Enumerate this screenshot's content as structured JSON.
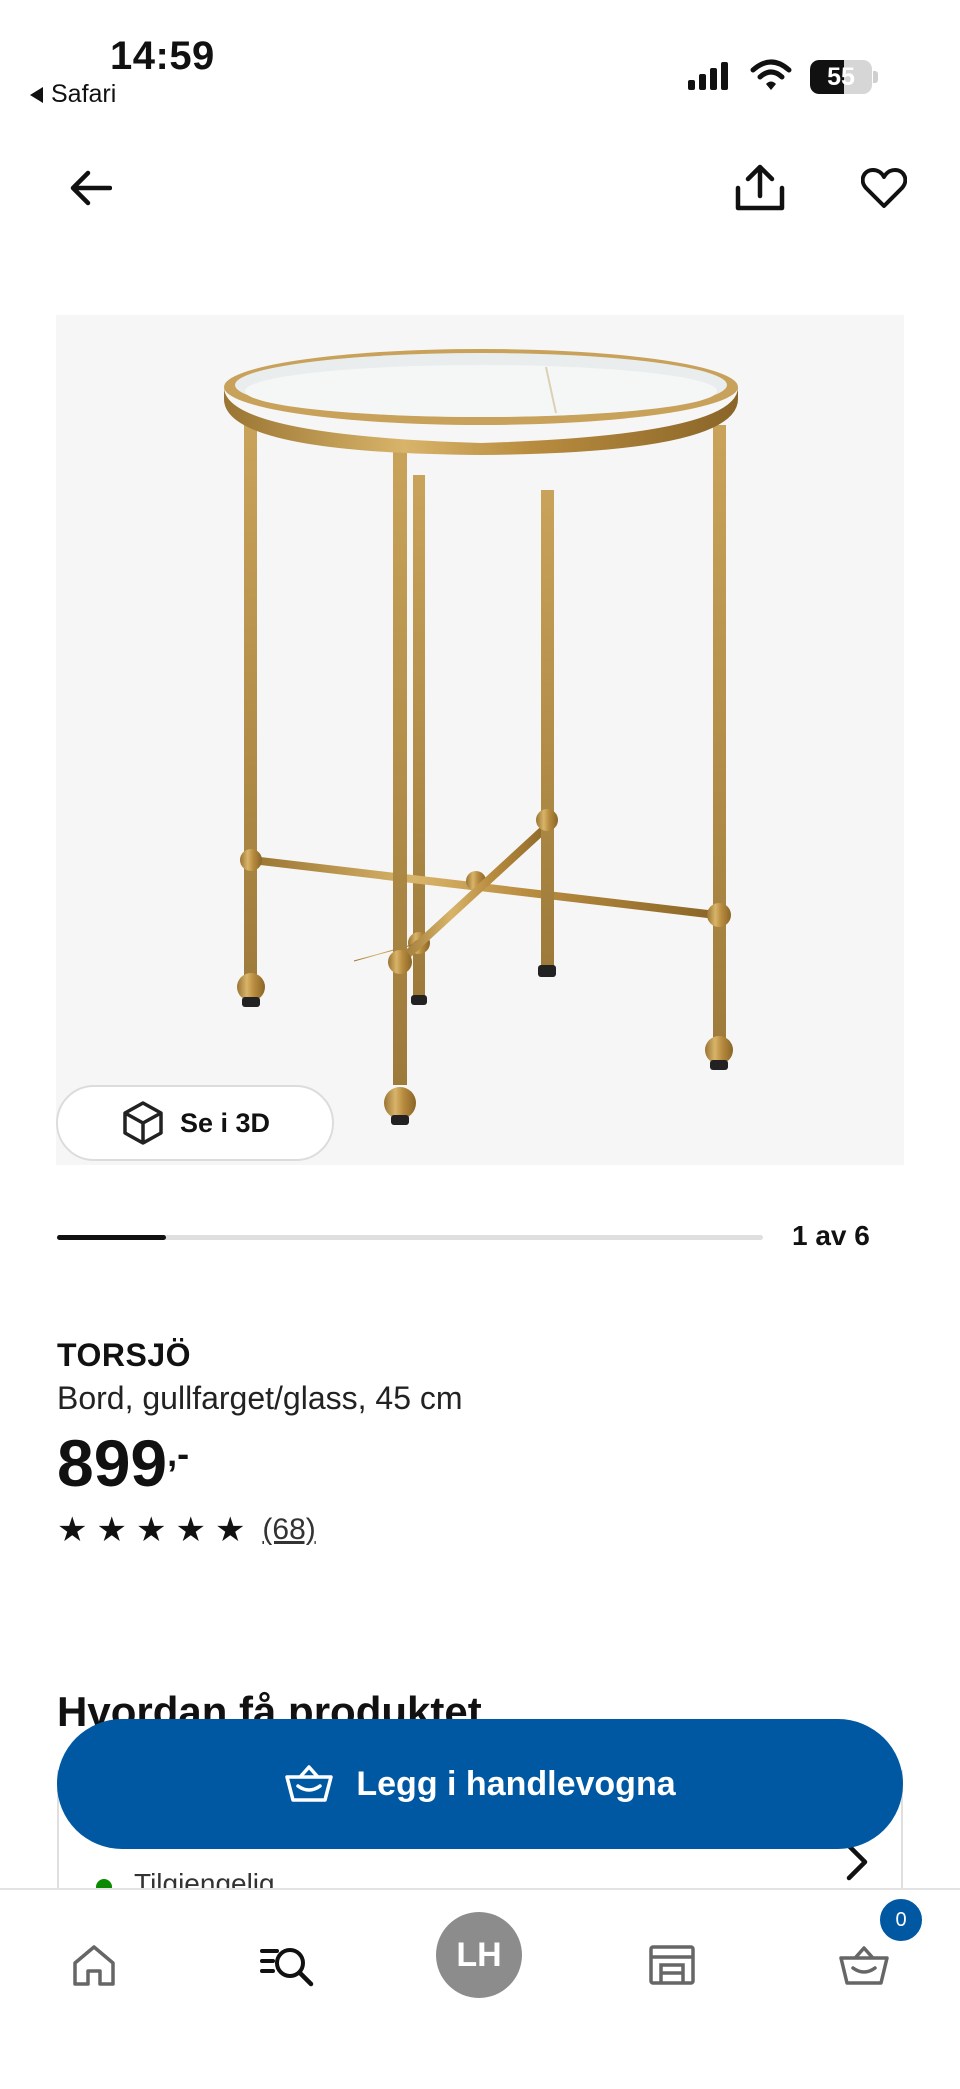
{
  "status_bar": {
    "time": "14:59",
    "back_app": "Safari",
    "battery": "55"
  },
  "product": {
    "view_3d_label": "Se i 3D",
    "gallery_counter": "1 av 6",
    "gallery_progress": 0.155,
    "brand": "TORSJÖ",
    "description": "Bord, gullfarget/glass, 45 cm",
    "price": "899",
    "price_suffix": ",-",
    "rating": 5,
    "review_count": "(68)"
  },
  "section": {
    "heading": "Hvordan få produktet",
    "availability": "Tilgjengelig"
  },
  "cta": {
    "label": "Legg i handlevogna"
  },
  "bottom_nav": {
    "items": [
      "home-icon",
      "search-icon",
      "profile-avatar",
      "store-icon",
      "cart-icon"
    ],
    "avatar_initials": "LH",
    "cart_badge": "0"
  },
  "colors": {
    "primary": "#0058a3",
    "gold": "#b8903c",
    "available": "#0a8a00"
  }
}
